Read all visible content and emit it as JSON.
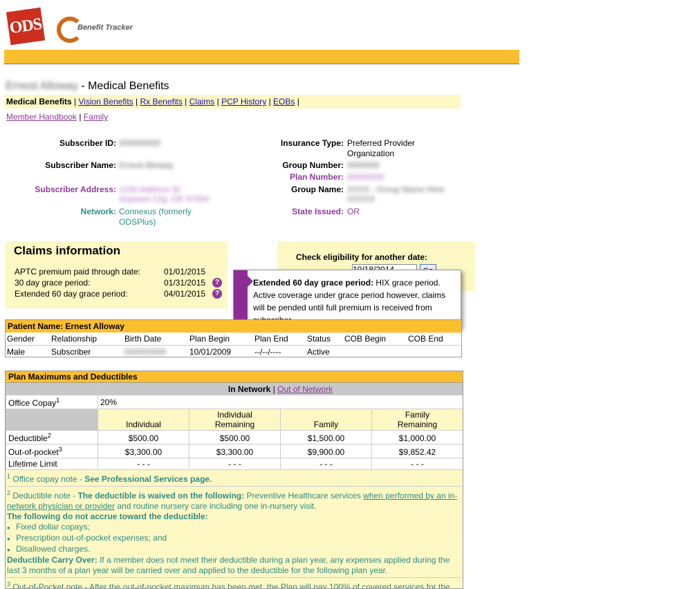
{
  "header": {
    "logo_ods": "ODS",
    "logo_benefit_tracker": "Benefit Tracker"
  },
  "title": {
    "member_name": "Ernest Alloway",
    "suffix": "- Medical Benefits"
  },
  "tabs": [
    {
      "label": "Medical Benefits",
      "active": true
    },
    {
      "label": "Vision Benefits"
    },
    {
      "label": "Rx Benefits"
    },
    {
      "label": "Claims"
    },
    {
      "label": "PCP History"
    },
    {
      "label": "EOBs"
    }
  ],
  "sublinks": {
    "member_handbook": "Member Handbook",
    "family": "Family"
  },
  "subscriber": {
    "id_label": "Subscriber ID:",
    "id_value": "000000000",
    "name_label": "Subscriber Name:",
    "name_value": "Ernest Alloway",
    "address_label": "Subscriber Address:",
    "address_line1": "1234 Address St",
    "address_line2": "Anytown City, OR 97000",
    "network_label": "Network:",
    "network_value_1": "Connexus (formerly",
    "network_value_2": "ODSPlus)",
    "insurance_type_label": "Insurance Type:",
    "insurance_type_1": "Preferred Provider",
    "insurance_type_2": "Organization",
    "group_number_label": "Group Number:",
    "group_number_value": "0000000",
    "plan_number_label": "Plan Number:",
    "plan_number_value": "00000000",
    "group_name_label": "Group Name:",
    "group_name_1": "XXXX - Group Name Here",
    "group_name_2": "XXXXX",
    "state_issued_label": "State Issued:",
    "state_issued_value": "OR"
  },
  "claims": {
    "title": "Claims information",
    "rows": [
      {
        "label": "APTC premium paid through date:",
        "value": "01/01/2015"
      },
      {
        "label": "30 day grace period:",
        "value": "01/31/2015"
      },
      {
        "label": "Extended 60 day grace period:",
        "value": "04/01/2015"
      }
    ]
  },
  "eligibility": {
    "title": "Check eligibility for another date:",
    "date_value": "10/18/2014",
    "go_label": "Go"
  },
  "tooltip": {
    "heading": "Extended 60 day grace period:",
    "text": "HIX grace period. Active coverage under grace period however, claims will be pended until full premium is received from subscriber"
  },
  "patient": {
    "header": "Patient Name: Ernest Alloway",
    "columns": [
      "Gender",
      "Relationship",
      "Birth Date",
      "Plan Begin",
      "Plan End",
      "Status",
      "COB Begin",
      "COB End"
    ],
    "row": [
      "Male",
      "Subscriber",
      "00/00/0000",
      "10/01/2009",
      "--/--/----",
      "Active",
      "",
      ""
    ]
  },
  "plan": {
    "header": "Plan Maximums and Deductibles",
    "network_in": "In Network",
    "network_sep": "|",
    "network_out": "Out of Network",
    "office_copay_label": "Office Copay",
    "office_copay_sup": "1",
    "office_copay_value": "20%",
    "col_individual": "Individual",
    "col_individual_remaining_1": "Individual",
    "col_individual_remaining_2": "Remaining",
    "col_family": "Family",
    "col_family_remaining_1": "Family",
    "col_family_remaining_2": "Remaining",
    "deductible_label": "Deductible",
    "deductible_sup": "2",
    "deductible": [
      "$500.00",
      "$500.00",
      "$1,500.00",
      "$1,000.00"
    ],
    "oop_label": "Out-of-pocket",
    "oop_sup": "3",
    "oop": [
      "$3,300.00",
      "$3,300.00",
      "$9,900.00",
      "$9,852.42"
    ],
    "lifetime_label": "Lifetime Limit",
    "lifetime": [
      "- - -",
      "- - -",
      "- - -",
      "- - -"
    ]
  },
  "notes": {
    "n1_sup": "1",
    "n1_text": "Office copay note -",
    "n1_bold": "See Professional Services page.",
    "n2_sup": "2",
    "n2_text": "Deductible note -",
    "n2_bold": "The deductible is waived on the following:",
    "n2_text2": "Preventive Healthcare services",
    "n2_link": "when performed by an in-network physician or provider",
    "n2_text3": "and routine nursery care including one in-nursery visit.",
    "n2_accrue": "The following do not accrue toward the deductible:",
    "n2_items": [
      "Fixed dollar copays;",
      "Prescription out-of-pocket expenses; and",
      "Disallowed charges."
    ],
    "n2_carry_bold": "Deductible Carry Over:",
    "n2_carry_text": "If a member does not meet their deductible during a plan year, any expenses applied during the last 3 months of a plan year will be carried over and applied to the deductible for the following plan year.",
    "n3_sup": "3",
    "n3_text": "Out-of-Pocket note - After the out-of-pocket maximum has been met, the Plan will pay 100% of covered services for the remainder of the year. The in-network out-of-pocket maximum can be used to satisfy both the in-network and out-of-"
  },
  "colors": {
    "accent_yellow": "#fbbf2e",
    "light_yellow": "#fdf8c4",
    "purple": "#8e3a99",
    "teal": "#2e8b86"
  }
}
